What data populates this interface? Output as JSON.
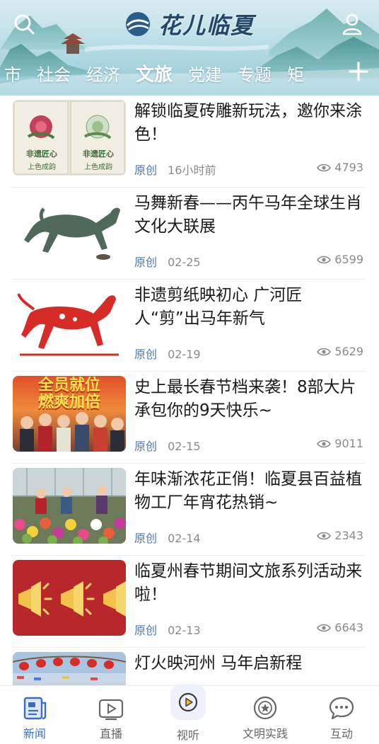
{
  "header": {
    "app_name": "花儿临夏",
    "channels": [
      "市",
      "社会",
      "经济",
      "文旅",
      "党建",
      "专题",
      "矩"
    ],
    "active_channel": "文旅"
  },
  "articles": [
    {
      "title": "解锁临夏砖雕新玩法，邀你来涂色！",
      "tag": "原创",
      "time": "16小时前",
      "views": "4793",
      "thumb_text": [
        "非遗匠心",
        "上色成韵"
      ]
    },
    {
      "title": "马舞新春——丙午马年全球生肖文化大联展",
      "tag": "原创",
      "time": "02-25",
      "views": "6599"
    },
    {
      "title": "非遗剪纸映初心  广河匠人“剪”出马年新气",
      "tag": "原创",
      "time": "02-19",
      "views": "5629"
    },
    {
      "title": "史上最长春节档来袭！8部大片承包你的9天快乐~",
      "tag": "原创",
      "time": "02-15",
      "views": "9011",
      "thumb_text": [
        "全员就位",
        "燃爽加倍"
      ]
    },
    {
      "title": "年味渐浓花正俏！临夏县百益植物工厂年宵花热销~",
      "tag": "原创",
      "time": "02-14",
      "views": "2343"
    },
    {
      "title": "临夏州春节期间文旅系列活动来啦！",
      "tag": "原创",
      "time": "02-13",
      "views": "6643"
    },
    {
      "title": "灯火映河州  马年启新程",
      "tag": "",
      "time": "",
      "views": ""
    }
  ],
  "bottom_nav": [
    {
      "label": "新闻",
      "icon": "news-icon",
      "active": true
    },
    {
      "label": "直播",
      "icon": "live-tv-icon",
      "active": false
    },
    {
      "label": "视听",
      "icon": "play-video-icon",
      "active": false
    },
    {
      "label": "文明实践",
      "icon": "civilization-badge-icon",
      "active": false
    },
    {
      "label": "互动",
      "icon": "chat-bubble-icon",
      "active": false
    }
  ],
  "colors": {
    "accent": "#3b6ec2",
    "tag": "#4a78b8",
    "title_text": "#1a1a1a",
    "meta_text": "#8a8a8a",
    "header_sky": "#c2e1e8"
  }
}
